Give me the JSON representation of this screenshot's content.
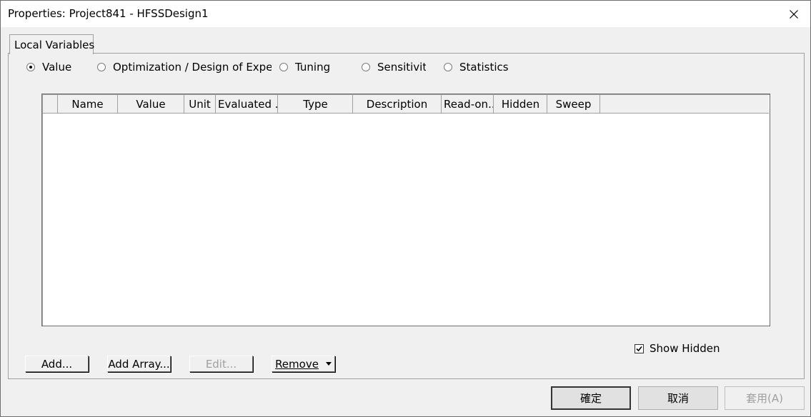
{
  "window": {
    "title": "Properties: Project841 - HFSSDesign1"
  },
  "tabs": [
    {
      "label": "Local Variables"
    }
  ],
  "radio_options": [
    {
      "label": "Value",
      "checked": true
    },
    {
      "label": "Optimization / Design of Experir",
      "checked": false
    },
    {
      "label": "Tuning",
      "checked": false
    },
    {
      "label": "Sensitivity",
      "checked": false
    },
    {
      "label": "Statistics",
      "checked": false
    }
  ],
  "grid": {
    "columns": [
      "",
      "Name",
      "Value",
      "Unit",
      "Evaluated ...",
      "Type",
      "Description",
      "Read-on...",
      "Hidden",
      "Sweep"
    ],
    "rows": []
  },
  "show_hidden": {
    "label": "Show Hidden",
    "checked": true
  },
  "buttons": {
    "add": "Add...",
    "add_array": "Add Array...",
    "edit": "Edit...",
    "remove": "Remove"
  },
  "dialog_buttons": {
    "ok": "確定",
    "cancel": "取消",
    "apply": "套用(A)"
  }
}
